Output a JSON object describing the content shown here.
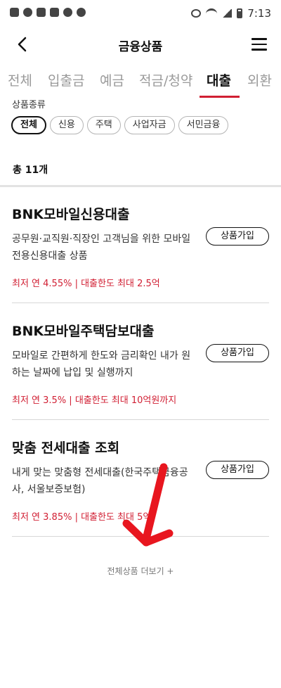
{
  "status_bar": {
    "time": "7:13"
  },
  "header": {
    "title": "금융상품"
  },
  "tabs": [
    {
      "label": "전체"
    },
    {
      "label": "입출금"
    },
    {
      "label": "예금"
    },
    {
      "label": "적금/청약"
    },
    {
      "label": "대출"
    },
    {
      "label": "외환"
    }
  ],
  "filter": {
    "label": "상품종류",
    "chips": [
      {
        "label": "전체"
      },
      {
        "label": "신용"
      },
      {
        "label": "주택"
      },
      {
        "label": "사업자금"
      },
      {
        "label": "서민금융"
      }
    ]
  },
  "total_count": "총 11개",
  "products": [
    {
      "name": "BNK모바일신용대출",
      "description": "공무원·교직원·직장인 고객님을 위한 모바일전용신용대출 상품",
      "rate": "최저 연 4.55% | 대출한도 최대 2.5억",
      "button": "상품가입"
    },
    {
      "name": "BNK모바일주택담보대출",
      "description": "모바일로 간편하게 한도와 금리확인 내가 원하는 날짜에 납입 및 실행까지",
      "rate": "최저 연 3.5% | 대출한도 최대 10억원까지",
      "button": "상품가입"
    },
    {
      "name": "맞춤 전세대출 조회",
      "description": "내게 맞는 맞춤형 전세대출(한국주택금융공사, 서울보증보험)",
      "rate": "최저 연 3.85% | 대출한도 최대 5억",
      "button": "상품가입"
    }
  ],
  "more_link": "전체상품 더보기 +",
  "colors": {
    "accent": "#d11f33",
    "arrow": "#e8161f"
  }
}
